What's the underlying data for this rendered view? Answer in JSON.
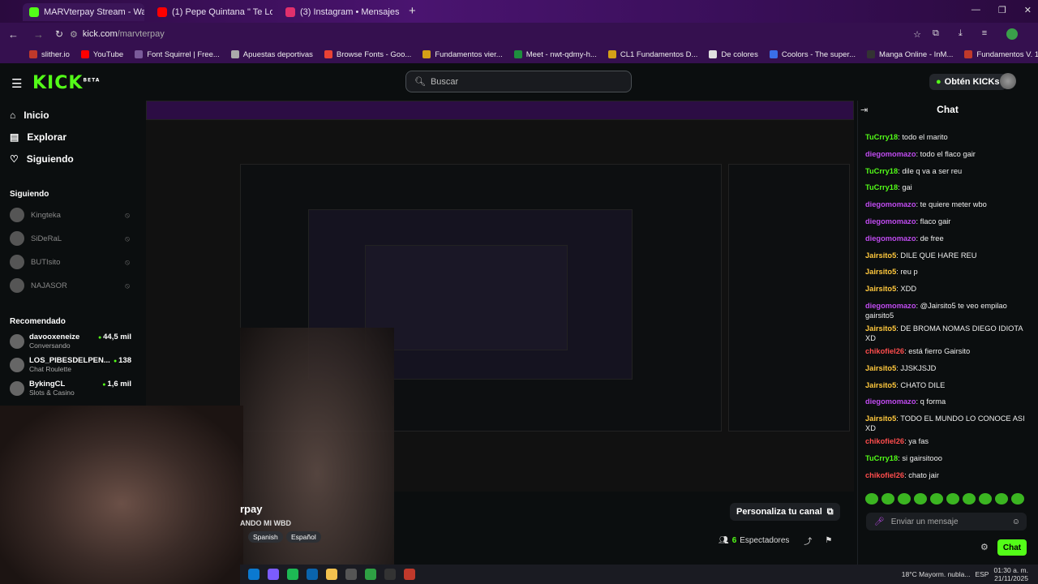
{
  "browser": {
    "tabs": [
      {
        "label": "MARVterpay Stream - Watch Li",
        "color": "#53fc18",
        "active": true
      },
      {
        "label": "(1) Pepe Quintana \" Te Lo Met",
        "color": "#ff0000",
        "active": false
      },
      {
        "label": "(3) Instagram • Mensajes",
        "color": "#e1306c",
        "active": false
      }
    ],
    "url_host": "kick.com",
    "url_path": "/marvterpay",
    "bookmarks": [
      "slither.io",
      "YouTube",
      "Font Squirrel | Free...",
      "Apuestas deportivas",
      "Browse Fonts - Goo...",
      "Fundamentos vier...",
      "Meet - nwt-qdmy-h...",
      "CL1 Fundamentos D...",
      "De colores",
      "Coolors - The super...",
      "Manga Online - InM...",
      "Fundamentos V. 1 v..."
    ]
  },
  "header": {
    "logo": "KICK",
    "logo_sup": "BETA",
    "search_placeholder": "Buscar",
    "get_kicks": "Obtén KICKs"
  },
  "sidebar": {
    "nav": [
      "Inicio",
      "Explorar",
      "Siguiendo"
    ],
    "following_title": "Siguiendo",
    "following": [
      "Kingteka",
      "SiDeRaL",
      "BUTIsito",
      "NAJASOR"
    ],
    "recommended_title": "Recomendado",
    "recommended": [
      {
        "name": "davooxeneize",
        "cat": "Conversando",
        "viewers": "44,5 mil"
      },
      {
        "name": "LOS_PIBESDELPEN...",
        "cat": "Chat Roulette",
        "viewers": "138"
      },
      {
        "name": "BykingCL",
        "cat": "Slots & Casino",
        "viewers": "1,6 mil"
      }
    ]
  },
  "stream": {
    "title_partial": "rpay",
    "subtitle_partial": "ANDO MI WBD",
    "tags": [
      "Spanish",
      "Español"
    ],
    "personaliza": "Personaliza tu canal",
    "viewers": "6",
    "viewers_label": "Espectadores"
  },
  "chat": {
    "title": "Chat",
    "messages": [
      {
        "user": "TuCrry18",
        "color": "#53fc18",
        "text": "todo el marito"
      },
      {
        "user": "diegomomazo",
        "color": "#c04bf0",
        "text": "todo el flaco gair"
      },
      {
        "user": "TuCrry18",
        "color": "#53fc18",
        "text": "dile q va a ser reu"
      },
      {
        "user": "TuCrry18",
        "color": "#53fc18",
        "text": "gai"
      },
      {
        "user": "diegomomazo",
        "color": "#c04bf0",
        "text": "te quiere meter wbo"
      },
      {
        "user": "diegomomazo",
        "color": "#c04bf0",
        "text": "flaco gair"
      },
      {
        "user": "diegomomazo",
        "color": "#c04bf0",
        "text": "de free"
      },
      {
        "user": "Jairsito5",
        "color": "#ffc83d",
        "text": "DILE QUE HARE REU"
      },
      {
        "user": "Jairsito5",
        "color": "#ffc83d",
        "text": "reu p"
      },
      {
        "user": "Jairsito5",
        "color": "#ffc83d",
        "text": "XDD"
      },
      {
        "user": "diegomomazo",
        "color": "#c04bf0",
        "text": "@Jairsito5 te veo empilao gairsito5"
      },
      {
        "user": "Jairsito5",
        "color": "#ffc83d",
        "text": "DE BROMA NOMAS DIEGO IDIOTA XD"
      },
      {
        "user": "chikofiel26",
        "color": "#ff4d4d",
        "text": "está fierro Gairsito"
      },
      {
        "user": "Jairsito5",
        "color": "#ffc83d",
        "text": "JJSKJSJD"
      },
      {
        "user": "Jairsito5",
        "color": "#ffc83d",
        "text": "CHATO DILE"
      },
      {
        "user": "diegomomazo",
        "color": "#c04bf0",
        "text": "q forma"
      },
      {
        "user": "Jairsito5",
        "color": "#ffc83d",
        "text": "TODO EL MUNDO LO CONOCE ASI XD"
      },
      {
        "user": "chikofiel26",
        "color": "#ff4d4d",
        "text": "ya fas"
      },
      {
        "user": "TuCrry18",
        "color": "#53fc18",
        "text": "si gairsitooo"
      },
      {
        "user": "chikofiel26",
        "color": "#ff4d4d",
        "text": "chato jair"
      }
    ],
    "input_placeholder": "Enviar un mensaje",
    "send": "Chat"
  },
  "taskbar": {
    "weather": "18°C  Mayorm. nubla...",
    "lang": "ESP",
    "time": "01:30 a. m.",
    "date": "21/11/2025"
  },
  "colors": {
    "accent": "#53fc18",
    "tabbar": "#4a1470"
  }
}
